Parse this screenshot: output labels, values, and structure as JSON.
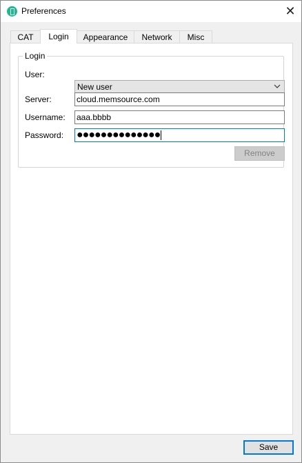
{
  "window": {
    "title": "Preferences"
  },
  "tabs": [
    {
      "label": "CAT"
    },
    {
      "label": "Login"
    },
    {
      "label": "Appearance"
    },
    {
      "label": "Network"
    },
    {
      "label": "Misc"
    }
  ],
  "active_tab": "Login",
  "login_group": {
    "legend": "Login",
    "user_label": "User:",
    "user_value": "New user",
    "server_label": "Server:",
    "server_value": "cloud.memsource.com",
    "username_label": "Username:",
    "username_value": "aaa.bbbb",
    "password_label": "Password:",
    "password_mask": "●●●●●●●●●●●●●●",
    "remove_label": "Remove"
  },
  "footer": {
    "save_label": "Save"
  },
  "colors": {
    "accent": "#0078d7",
    "app_icon": "#1db98f"
  },
  "icons": {
    "app": "memsource-app-icon",
    "close": "close-icon",
    "dropdown": "chevron-down-icon"
  }
}
